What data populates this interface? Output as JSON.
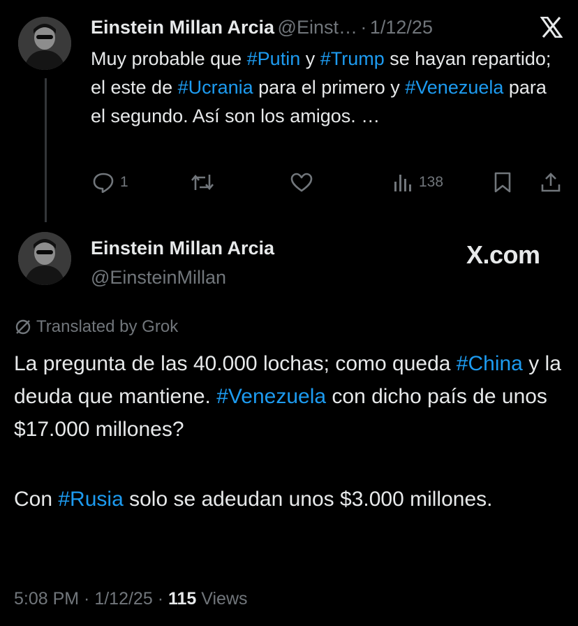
{
  "reply_tweet": {
    "author_name": "Einstein Millan Arcia",
    "handle": "@Einst…",
    "separator": "·",
    "date": "1/12/25",
    "text_parts": {
      "p1": "Muy probable que ",
      "t1": "#Putin",
      "p2": " y ",
      "t2": "#Trump",
      "p3": " se hayan repartido; el este de ",
      "t3": "#Ucrania",
      "p4": " para el primero y ",
      "t4": "#Venezuela",
      "p5": " para el segundo. Así son los amigos. …"
    },
    "actions": {
      "reply_count": "1",
      "views_count": "138"
    }
  },
  "main_tweet": {
    "author_name": "Einstein Millan Arcia",
    "handle": "@EinsteinMillan",
    "watermark": "X.com",
    "translated_label": "Translated by Grok",
    "paragraph1": {
      "p1": "La pregunta de las 40.000 lochas; como queda ",
      "t1": "#China",
      "p2": " y la deuda que mantiene. ",
      "t2": "#Venezuela",
      "p3": " con dicho país de unos $17.000 millones?"
    },
    "paragraph2": {
      "p1": "Con ",
      "t1": "#Rusia",
      "p2": " solo se adeudan unos $3.000 millones."
    },
    "footer": {
      "time": "5:08 PM",
      "sep1": " · ",
      "date": "1/12/25",
      "sep2": " · ",
      "views_count": "115",
      "views_label": " Views"
    }
  },
  "colors": {
    "background": "#000000",
    "text": "#e7e9ea",
    "muted": "#71767b",
    "hashtag": "#1d9bf0"
  },
  "icons": [
    "x-logo-icon",
    "reply-icon",
    "retweet-icon",
    "like-icon",
    "views-icon",
    "bookmark-icon",
    "share-icon",
    "translate-icon"
  ]
}
